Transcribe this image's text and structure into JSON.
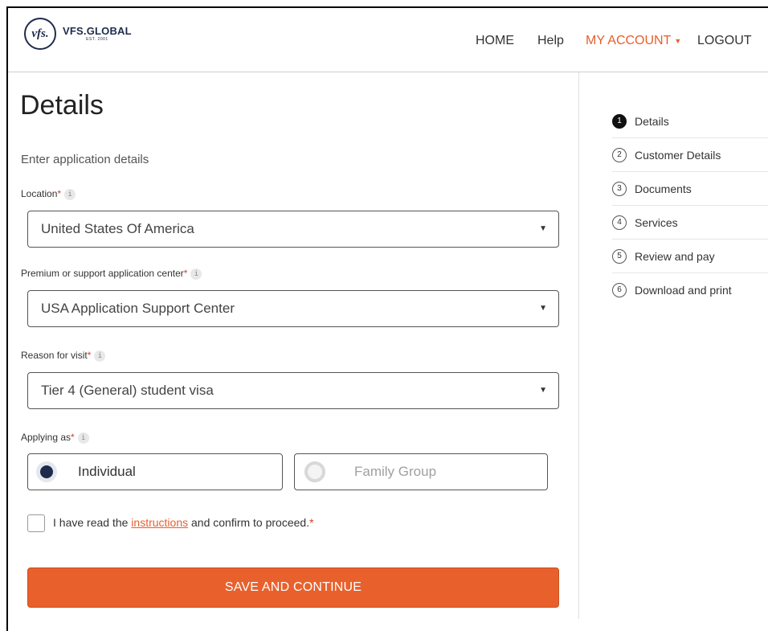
{
  "header": {
    "logo_mark": "vfs.",
    "logo_name": "VFS.GLOBAL",
    "logo_est": "EST. 2001",
    "nav": [
      {
        "label": "HOME"
      },
      {
        "label": "Help"
      },
      {
        "label": "MY ACCOUNT"
      },
      {
        "label": "LOGOUT"
      }
    ]
  },
  "main": {
    "title": "Details",
    "subtitle": "Enter application details",
    "location": {
      "label": "Location",
      "value": "United States Of America"
    },
    "center": {
      "label": "Premium or support application center",
      "value": "USA Application Support Center"
    },
    "reason": {
      "label": "Reason for visit",
      "value": "Tier 4 (General) student visa"
    },
    "applying_as": {
      "label": "Applying as",
      "options": [
        "Individual",
        "Family Group"
      ],
      "selected": "Individual"
    },
    "confirm": {
      "prefix": "I have read the",
      "link": "instructions",
      "suffix": "and confirm to proceed."
    },
    "save_label": "SAVE AND CONTINUE",
    "required_mark": "*",
    "info_glyph": "i"
  },
  "steps": [
    {
      "num": "1",
      "label": "Details",
      "current": true
    },
    {
      "num": "2",
      "label": "Customer Details"
    },
    {
      "num": "3",
      "label": "Documents"
    },
    {
      "num": "4",
      "label": "Services"
    },
    {
      "num": "5",
      "label": "Review and pay"
    },
    {
      "num": "6",
      "label": "Download and print"
    }
  ],
  "colors": {
    "accent": "#e8612c",
    "navy": "#1f2b4b",
    "required": "#d43c2b"
  },
  "icons": [
    "info-icon",
    "chevron-down-icon",
    "radio-icon",
    "checkbox-icon"
  ]
}
